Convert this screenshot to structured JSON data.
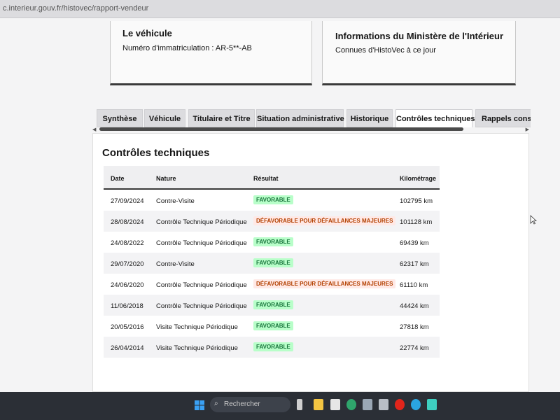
{
  "browser": {
    "url": "c.interieur.gouv.fr/histovec/rapport-vendeur"
  },
  "vehicle_card": {
    "title": "Le véhicule",
    "plate_text": "Numéro d'immatriculation : AR-5**-AB"
  },
  "ministry_card": {
    "title": "Informations du Ministère de l'Intérieur",
    "text": "Connues d'HistoVec à ce jour"
  },
  "tabs": [
    {
      "label": "Synthèse"
    },
    {
      "label": "Véhicule"
    },
    {
      "label": "Titulaire et Titre"
    },
    {
      "label": "Situation administrative"
    },
    {
      "label": "Historique"
    },
    {
      "label": "Contrôles techniques",
      "active": true
    },
    {
      "label": "Rappels constructeur"
    }
  ],
  "panel": {
    "title": "Contrôles techniques",
    "columns": {
      "date": "Date",
      "nature": "Nature",
      "result": "Résultat",
      "km": "Kilométrage"
    },
    "rows": [
      {
        "date": "27/09/2024",
        "nature": "Contre-Visite",
        "result": "FAVORABLE",
        "km": "102795 km"
      },
      {
        "date": "28/08/2024",
        "nature": "Contrôle Technique Périodique",
        "result": "DÉFAVORABLE POUR DÉFAILLANCES MAJEURES",
        "km": "101128 km"
      },
      {
        "date": "24/08/2022",
        "nature": "Contrôle Technique Périodique",
        "result": "FAVORABLE",
        "km": "69439 km"
      },
      {
        "date": "29/07/2020",
        "nature": "Contre-Visite",
        "result": "FAVORABLE",
        "km": "62317 km"
      },
      {
        "date": "24/06/2020",
        "nature": "Contrôle Technique Périodique",
        "result": "DÉFAVORABLE POUR DÉFAILLANCES MAJEURES",
        "km": "61110 km"
      },
      {
        "date": "11/06/2018",
        "nature": "Contrôle Technique Périodique",
        "result": "FAVORABLE",
        "km": "44424 km"
      },
      {
        "date": "20/05/2016",
        "nature": "Visite Technique Périodique",
        "result": "FAVORABLE",
        "km": "27818 km"
      },
      {
        "date": "26/04/2014",
        "nature": "Visite Technique Périodique",
        "result": "FAVORABLE",
        "km": "22774 km"
      }
    ]
  },
  "taskbar": {
    "search_placeholder": "Rechercher",
    "icons": [
      "windows-start-icon",
      "search-icon",
      "file-explorer-icon",
      "chrome-icon",
      "opera-icon",
      "edge-icon"
    ]
  },
  "colors": {
    "favorable_bg": "#b8fec9",
    "favorable_text": "#18753c",
    "defavorable_bg": "#ffe9e6",
    "defavorable_text": "#b34000"
  }
}
